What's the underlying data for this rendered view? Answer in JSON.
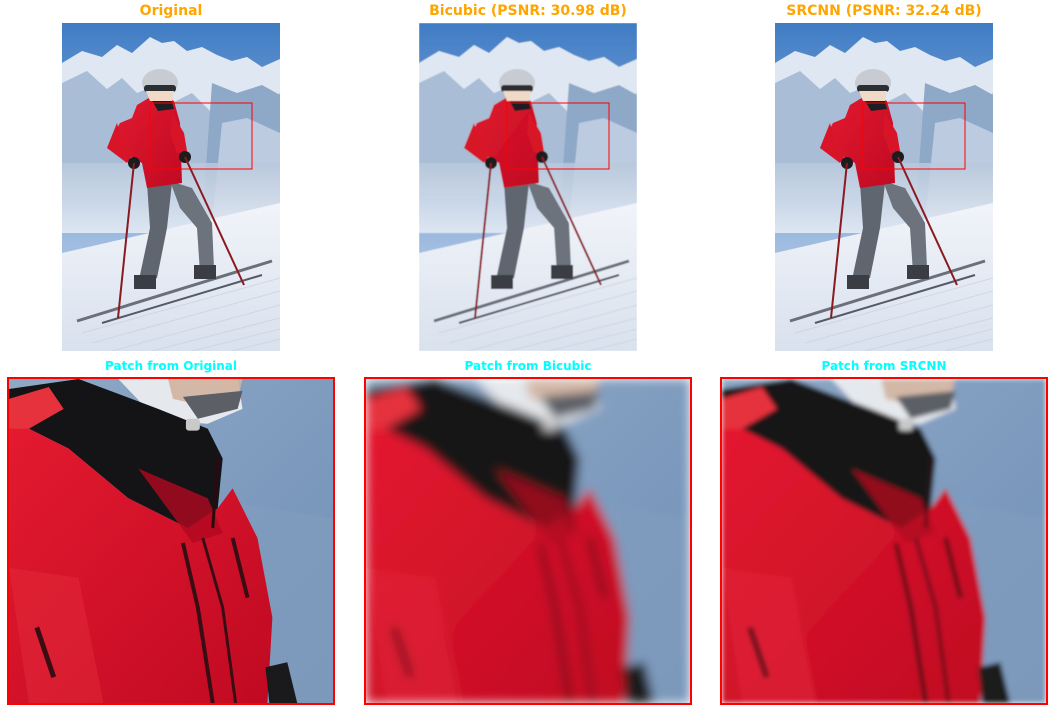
{
  "figure": {
    "panels": [
      {
        "key": "original",
        "title": "Original"
      },
      {
        "key": "bicubic",
        "title": "Bicubic (PSNR: 30.98 dB)"
      },
      {
        "key": "srcnn",
        "title": "SRCNN (PSNR: 32.24 dB)"
      }
    ],
    "patches": [
      {
        "key": "original",
        "title": "Patch from Original"
      },
      {
        "key": "bicubic",
        "title": "Patch from Bicubic"
      },
      {
        "key": "srcnn",
        "title": "Patch from SRCNN"
      }
    ]
  },
  "colors": {
    "top_title": "#ffa500",
    "patch_title": "#00ffff",
    "highlight_box": "#ff0000",
    "jacket": "#d8102a",
    "sky": "#4f86c8",
    "snow": "#eef2f8"
  },
  "image_content": {
    "scene": "skier-on-snow-slope",
    "patch_region": "jacket-collar"
  }
}
